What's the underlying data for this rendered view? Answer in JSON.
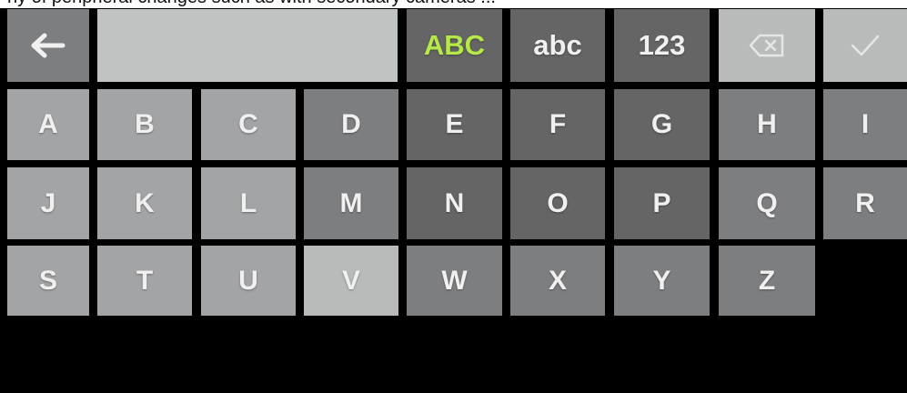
{
  "top_caption": "ny of peripheral  changes such as  with secondary cameras ...",
  "toolbar": {
    "back_icon": "arrow-left-icon",
    "text_value": "",
    "mode_upper": "ABC",
    "mode_lower": "abc",
    "mode_numbers": "123",
    "backspace_icon": "backspace-icon",
    "confirm_icon": "checkmark-icon",
    "active_color": "#b6e84a"
  },
  "keyboard": {
    "rows": [
      [
        "A",
        "B",
        "C",
        "D",
        "E",
        "F",
        "G",
        "H",
        "I"
      ],
      [
        "J",
        "K",
        "L",
        "M",
        "N",
        "O",
        "P",
        "Q",
        "R"
      ],
      [
        "S",
        "T",
        "U",
        "V",
        "W",
        "X",
        "Y",
        "Z"
      ]
    ]
  }
}
